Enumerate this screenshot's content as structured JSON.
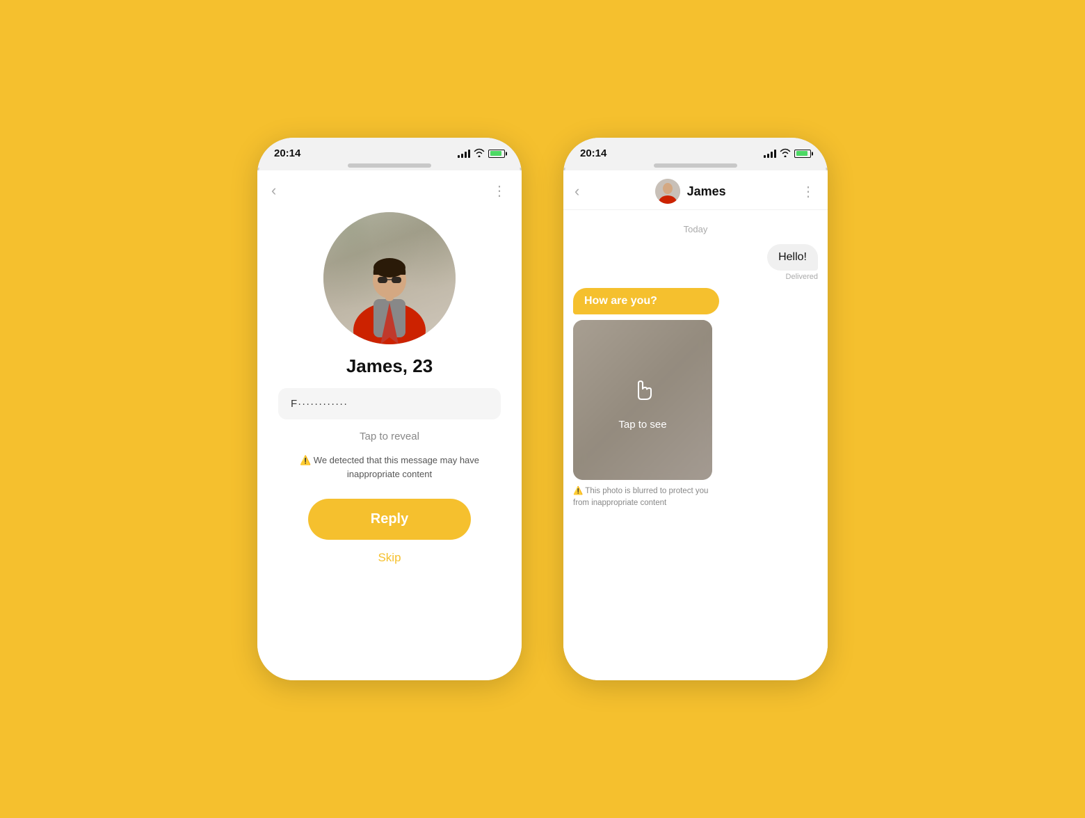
{
  "background_color": "#F5C02E",
  "phone_left": {
    "status_time": "20:14",
    "nav": {
      "back_label": "‹",
      "dots_label": "⋮"
    },
    "profile": {
      "name": "James, 23",
      "message_placeholder": "F············",
      "tap_reveal": "Tap to reveal",
      "warning": "⚠️ We detected that this message may have inappropriate content",
      "reply_button": "Reply",
      "skip_link": "Skip"
    }
  },
  "phone_right": {
    "status_time": "20:14",
    "nav": {
      "back_label": "‹",
      "contact_name": "James",
      "dots_label": "⋮"
    },
    "chat": {
      "date_label": "Today",
      "messages": [
        {
          "type": "sent",
          "text": "Hello!",
          "status": "Delivered"
        },
        {
          "type": "received",
          "text": "How are you?"
        },
        {
          "type": "received_image",
          "tap_label": "Tap to see"
        }
      ],
      "photo_warning": "⚠️ This photo is blurred to protect you from inappropriate content"
    }
  },
  "icons": {
    "back": "‹",
    "dots": "⋮",
    "warning": "⚠️"
  }
}
